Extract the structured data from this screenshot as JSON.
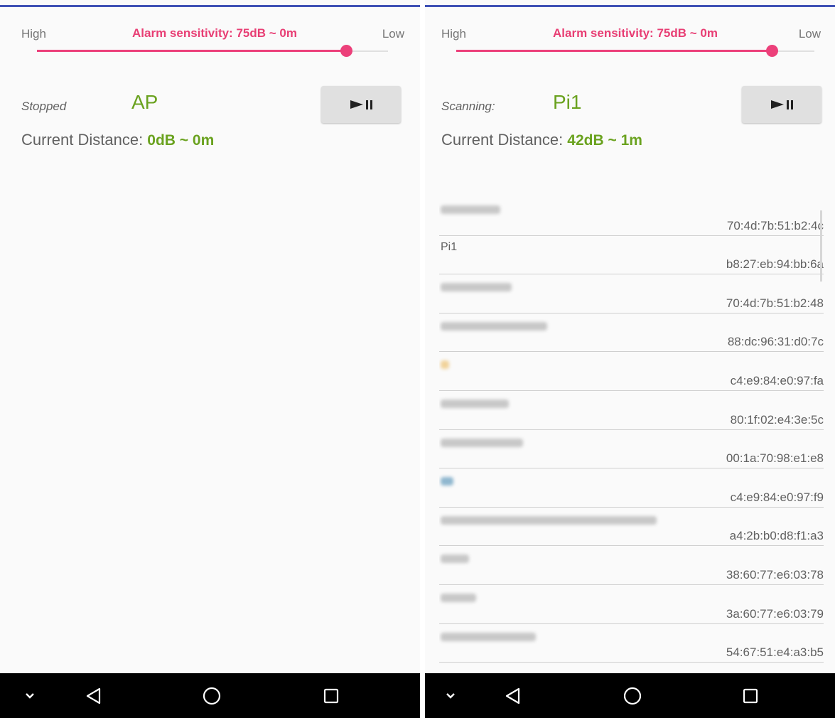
{
  "sensitivity": {
    "high_label": "High",
    "low_label": "Low",
    "label": "Alarm sensitivity: 75dB ~ 0m",
    "slider_fraction": 0.88
  },
  "screens": [
    {
      "status": "Stopped",
      "target": "AP",
      "distance_prefix": "Current Distance: ",
      "distance_value": "0dB ~ 0m",
      "devices": []
    },
    {
      "status": "Scanning:",
      "target": "Pi1",
      "distance_prefix": "Current Distance: ",
      "distance_value": "42dB ~ 1m",
      "devices": [
        {
          "name": "",
          "mac": "70:4d:7b:51:b2:4c"
        },
        {
          "name": "Pi1",
          "mac": "b8:27:eb:94:bb:6a"
        },
        {
          "name": "",
          "mac": "70:4d:7b:51:b2:48"
        },
        {
          "name": "",
          "mac": "88:dc:96:31:d0:7c"
        },
        {
          "name": "",
          "mac": "c4:e9:84:e0:97:fa"
        },
        {
          "name": "",
          "mac": "80:1f:02:e4:3e:5c"
        },
        {
          "name": "",
          "mac": "00:1a:70:98:e1:e8"
        },
        {
          "name": "",
          "mac": "c4:e9:84:e0:97:f9"
        },
        {
          "name": "",
          "mac": "a4:2b:b0:d8:f1:a3"
        },
        {
          "name": "",
          "mac": "38:60:77:e6:03:78"
        },
        {
          "name": "",
          "mac": "3a:60:77:e6:03:79"
        },
        {
          "name": "",
          "mac": "54:67:51:e4:a3:b5"
        }
      ]
    }
  ],
  "colors": {
    "accent_pink": "#ec407a",
    "accent_green": "#6aa21f",
    "top_bar": "#3f51b5"
  },
  "icons": {
    "play_pause": "play-pause-icon",
    "nav_hide": "chevron-down-icon",
    "nav_back": "back-triangle-icon",
    "nav_home": "home-circle-icon",
    "nav_recents": "recents-square-icon"
  }
}
